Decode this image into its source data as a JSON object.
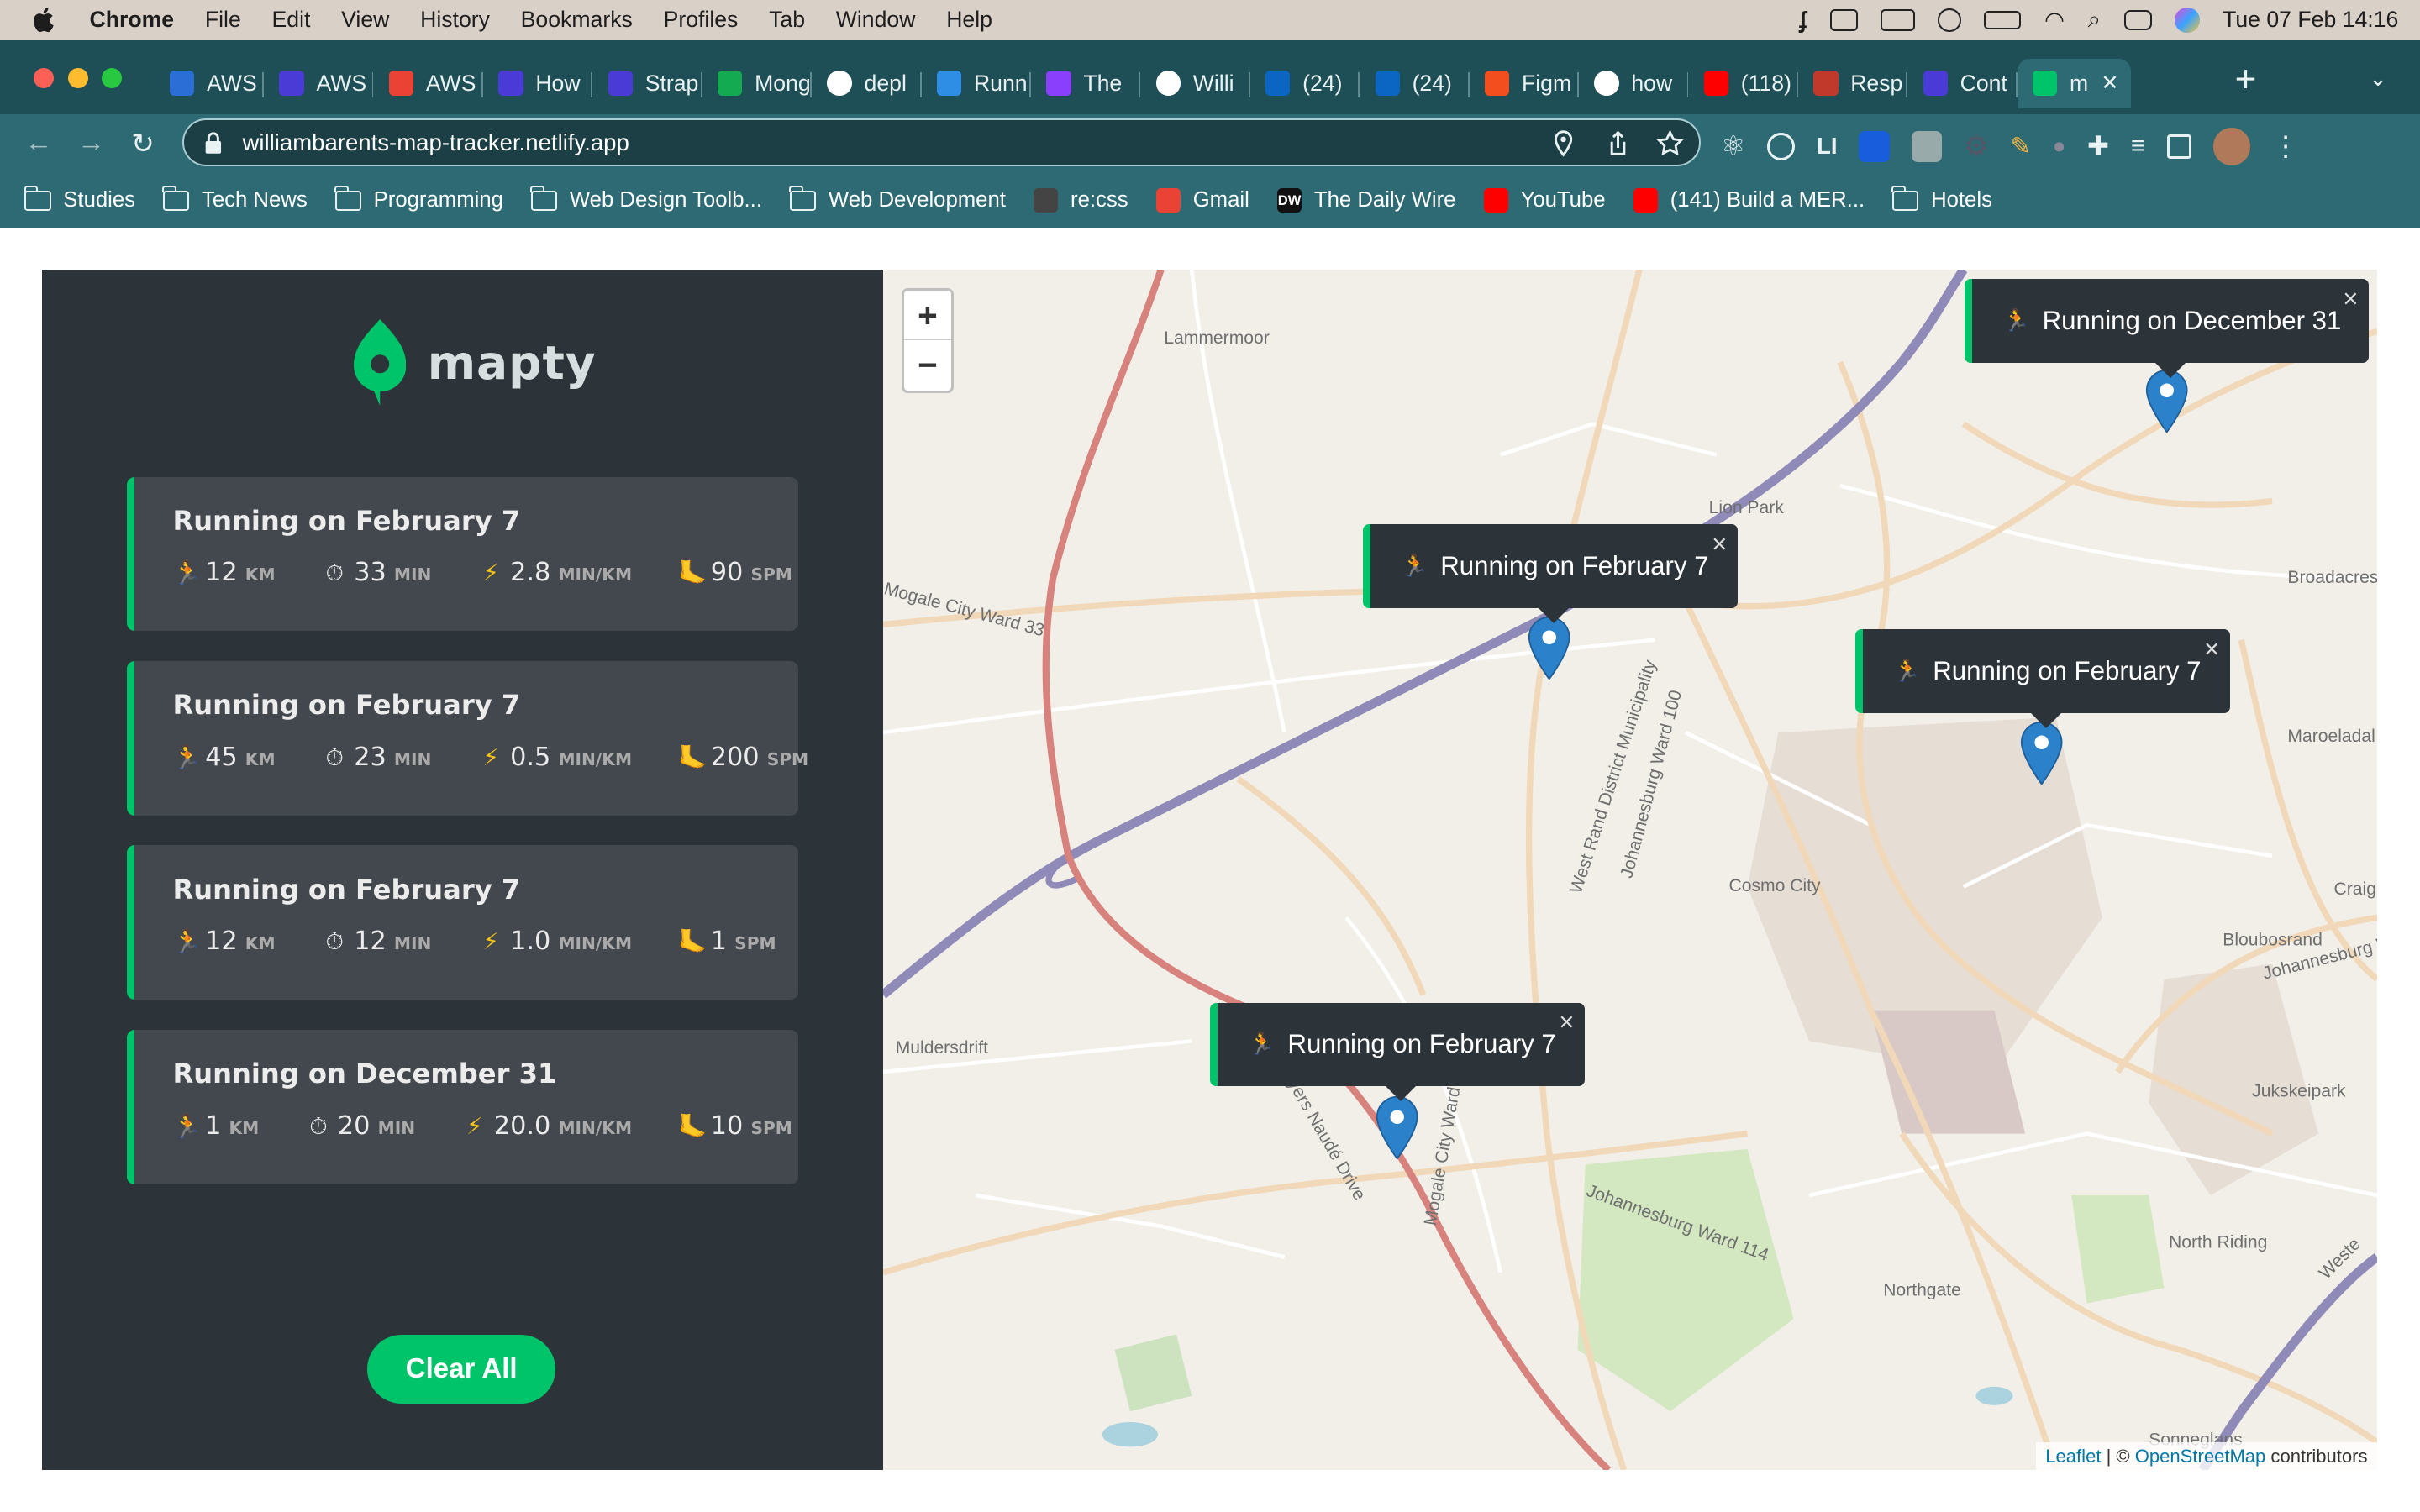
{
  "menubar": {
    "items": [
      "Chrome",
      "File",
      "Edit",
      "View",
      "History",
      "Bookmarks",
      "Profiles",
      "Tab",
      "Window",
      "Help"
    ],
    "datetime": "Tue 07 Feb  14:16"
  },
  "tabs": [
    {
      "label": "AWS",
      "color": "#2b6fd6",
      "icon": "globe-icon"
    },
    {
      "label": "AWS",
      "color": "#4b3bd6",
      "icon": "square-app-icon"
    },
    {
      "label": "AWS",
      "color": "#ea4335",
      "icon": "gmail-icon"
    },
    {
      "label": "How",
      "color": "#4b3bd6",
      "icon": "square-app-icon"
    },
    {
      "label": "Strap",
      "color": "#4b3bd6",
      "icon": "square-app-icon"
    },
    {
      "label": "Mong",
      "color": "#13aa52",
      "icon": "leaf-icon"
    },
    {
      "label": "depl",
      "color": "#ffffff",
      "icon": "google-icon"
    },
    {
      "label": "Runn",
      "color": "#2e8ee6",
      "icon": "vscode-icon"
    },
    {
      "label": "The",
      "color": "#8a3ffc",
      "icon": "app-icon"
    },
    {
      "label": "Willi",
      "color": "#ffffff",
      "icon": "github-icon"
    },
    {
      "label": "(24)",
      "color": "#0a66c2",
      "icon": "linkedin-icon"
    },
    {
      "label": "(24)",
      "color": "#0a66c2",
      "icon": "linkedin-icon"
    },
    {
      "label": "Figm",
      "color": "#f24e1e",
      "icon": "figma-icon"
    },
    {
      "label": "how",
      "color": "#ffffff",
      "icon": "google-icon"
    },
    {
      "label": "(118)",
      "color": "#ff0000",
      "icon": "youtube-icon"
    },
    {
      "label": "Resp",
      "color": "#c0392b",
      "icon": "app-icon"
    },
    {
      "label": "Cont",
      "color": "#4b3bd6",
      "icon": "app-icon"
    },
    {
      "label": "m",
      "color": "#00c46a",
      "icon": "map-pin-icon",
      "active": true
    }
  ],
  "address": {
    "url": "williambarents-map-tracker.netlify.app"
  },
  "bookmarks": [
    {
      "label": "Studies",
      "type": "folder"
    },
    {
      "label": "Tech News",
      "type": "folder"
    },
    {
      "label": "Programming",
      "type": "folder"
    },
    {
      "label": "Web Design Toolb...",
      "type": "folder"
    },
    {
      "label": "Web Development",
      "type": "folder"
    },
    {
      "label": "re:css",
      "type": "site",
      "color": "#444444"
    },
    {
      "label": "Gmail",
      "type": "site",
      "color": "#ea4335"
    },
    {
      "label": "The Daily Wire",
      "type": "site",
      "color": "#111111",
      "text": "DW"
    },
    {
      "label": "YouTube",
      "type": "site",
      "color": "#ff0000"
    },
    {
      "label": "(141) Build a MER...",
      "type": "site",
      "color": "#ff0000"
    },
    {
      "label": "Hotels",
      "type": "folder"
    }
  ],
  "app": {
    "logo_text": "mapty",
    "clear_label": "Clear All",
    "accent": "#00c46a",
    "workouts": [
      {
        "title": "Running on February 7",
        "distance": "12",
        "distance_unit": "KM",
        "duration": "33",
        "duration_unit": "MIN",
        "pace": "2.8",
        "pace_unit": "MIN/KM",
        "cadence": "90",
        "cadence_unit": "SPM"
      },
      {
        "title": "Running on February 7",
        "distance": "45",
        "distance_unit": "KM",
        "duration": "23",
        "duration_unit": "MIN",
        "pace": "0.5",
        "pace_unit": "MIN/KM",
        "cadence": "200",
        "cadence_unit": "SPM"
      },
      {
        "title": "Running on February 7",
        "distance": "12",
        "distance_unit": "KM",
        "duration": "12",
        "duration_unit": "MIN",
        "pace": "1.0",
        "pace_unit": "MIN/KM",
        "cadence": "1",
        "cadence_unit": "SPM"
      },
      {
        "title": "Running on December 31",
        "distance": "1",
        "distance_unit": "KM",
        "duration": "20",
        "duration_unit": "MIN",
        "pace": "20.0",
        "pace_unit": "MIN/KM",
        "cadence": "10",
        "cadence_unit": "SPM"
      }
    ]
  },
  "map": {
    "zoom_in": "+",
    "zoom_out": "−",
    "popups": [
      {
        "label": "Running on December 31"
      },
      {
        "label": "Running on February 7"
      },
      {
        "label": "Running on February 7"
      },
      {
        "label": "Running on February 7"
      }
    ],
    "labels": [
      "Lammermoor",
      "Lion Park",
      "Broadacres AH",
      "Maroeladal",
      "Craig",
      "Bloubosrand",
      "Cosmo City",
      "Muldersdrift",
      "Jukskeipark",
      "North Riding",
      "Northgate",
      "Johannesburg Ward 114",
      "West Rand District Municipality",
      "Johannesburg Ward 100",
      "Mogale City Ward 33",
      "Beyers Naudé Drive",
      "Mogale City Ward",
      "Johannesburg Wa",
      "Weste",
      "Sonneglans"
    ],
    "attribution": {
      "leaflet": "Leaflet",
      "sep": " | © ",
      "osm": "OpenStreetMap",
      "rest": " contributors"
    }
  }
}
